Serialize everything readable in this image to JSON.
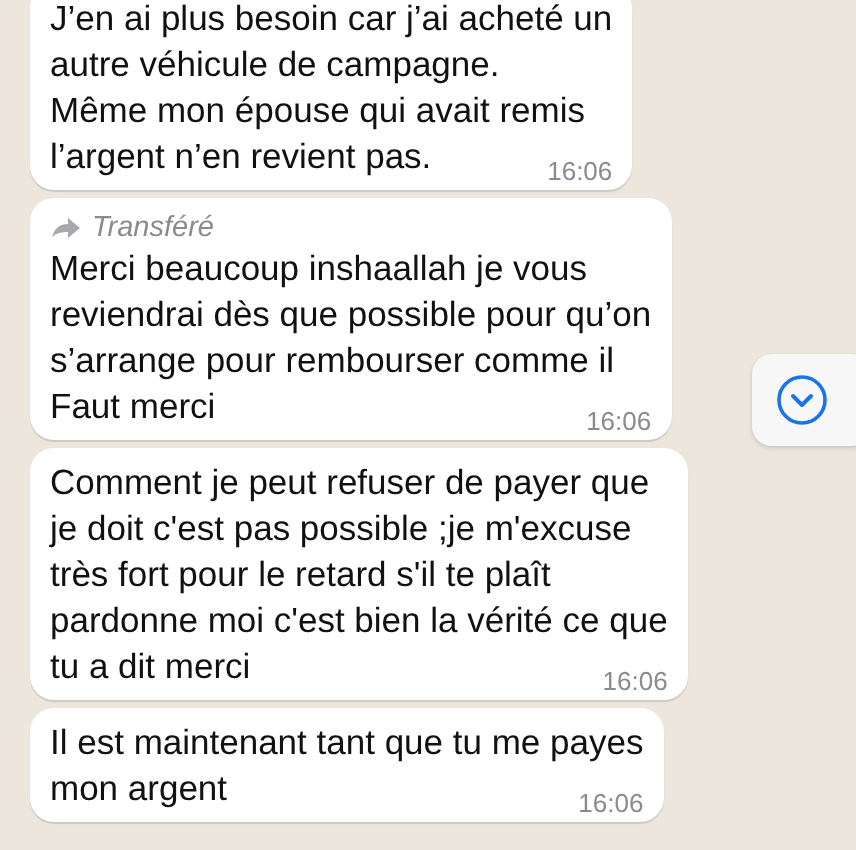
{
  "messages": [
    {
      "forwarded": false,
      "lines": [
        "J’en ai plus besoin car j’ai acheté un",
        "autre véhicule de campagne.",
        "Même mon épouse qui avait remis",
        "l’argent n’en revient pas."
      ],
      "time": "16:06"
    },
    {
      "forwarded": true,
      "forwarded_label": "Transféré",
      "lines": [
        "Merci beaucoup inshaallah je vous",
        "reviendrai dès que possible pour qu’on",
        "s’arrange pour rembourser comme il",
        "Faut merci"
      ],
      "time": "16:06"
    },
    {
      "forwarded": false,
      "lines": [
        "Comment je peut refuser de payer que",
        "je doit c'est pas possible ;je m'excuse",
        "très fort pour le retard s'il te plaît",
        "pardonne moi c'est bien la vérité ce que",
        "tu a dit merci"
      ],
      "time": "16:06"
    },
    {
      "forwarded": false,
      "lines": [
        "Il est maintenant tant que tu me payes",
        "mon argent"
      ],
      "time": "16:06"
    }
  ]
}
